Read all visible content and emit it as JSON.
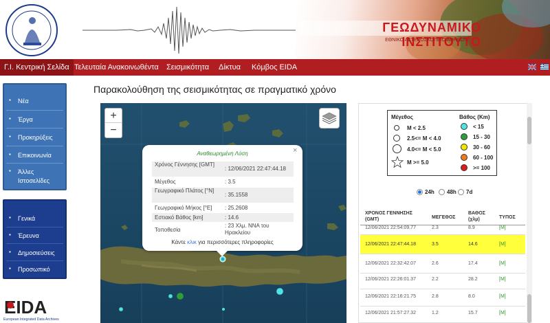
{
  "header": {
    "title": "ΓΕΩΔΥΝΑΜΙΚΟ ΙΝΣΤΙΤΟΥΤΟ",
    "subtitle": "ΕΘΝΙΚΟ ΑΣΤΕΡΟΣΚΟΠΕΙΟ ΑΘΗΝΩΝ"
  },
  "nav": {
    "items": [
      {
        "label": "Γ.Ι. Κεντρική Σελίδα"
      },
      {
        "label": "Τελευταία Ανακοινωθέντα"
      },
      {
        "label": "Σεισμικότητα"
      },
      {
        "label": "Δίκτυα"
      },
      {
        "label": "Κόμβος EIDA"
      }
    ]
  },
  "sidebar": {
    "group1": [
      "Νέα",
      "Έργα",
      "Προκηρύξεις",
      "Επικοινωνία",
      "Άλλες Ιστοσελίδες"
    ],
    "group2": [
      "Γενικά",
      "Έρευνα",
      "Δημοσιεύσεις",
      "Προσωπικό"
    ]
  },
  "eida": {
    "label": "EIDA",
    "caption": "European Integrated Data Archives"
  },
  "page_title": "Παρακολούθηση της σεισμικότητας σε πραγματικό χρόνο",
  "map": {
    "zoom_in": "+",
    "zoom_out": "−",
    "popup": {
      "close": "×",
      "heading": "Αναθεωρημένη Λύση",
      "rows": [
        {
          "key": "Χρόνος Γέννησης [GMT]",
          "value": ": 12/06/2021 22:47:44.18"
        },
        {
          "key": "Μέγεθος",
          "value": ": 3.5"
        },
        {
          "key": "Γεωγραφικό Πλάτος [°N]",
          "value": ": 35.1558"
        },
        {
          "key": "Γεωγραφικό Μήκος [°E]",
          "value": ": 25.2608"
        },
        {
          "key": "Εστιακό Βάθος [km]",
          "value": ": 14.6"
        },
        {
          "key": "Τοποθεσία",
          "value": ": 23 Χλμ. ΝΝΑ του Ηρακλείου"
        }
      ],
      "footer_pre": "Κάντε",
      "footer_link": "κλικ",
      "footer_post": "για περισσότερες πληροφορίες"
    }
  },
  "legend": {
    "magnitude_title": "Μέγεθος",
    "depth_title": "Βάθος (Km)",
    "magnitudes": [
      "M < 2.5",
      "2.5<= M < 4.0",
      "4.0<= M < 5.0",
      "M >= 5.0"
    ],
    "depths": [
      {
        "label": "< 15",
        "color": "#4fe3e3"
      },
      {
        "label": "15 - 30",
        "color": "#2e9e3a"
      },
      {
        "label": "30 - 60",
        "color": "#f2e600"
      },
      {
        "label": "60 - 100",
        "color": "#f07a1a"
      },
      {
        "label": ">= 100",
        "color": "#d81e1e"
      }
    ]
  },
  "period": {
    "options": [
      "24h",
      "48h",
      "7d"
    ],
    "selected": "24h"
  },
  "table": {
    "headers": {
      "time": "ΧΡΟΝΟΣ ΓΕΝΝΗΣΗΣ (GMT)",
      "magnitude": "ΜΕΓΕΘΟΣ",
      "depth": "ΒΑΘΟΣ (χλμ)",
      "type": "ΤΥΠΟΣ"
    },
    "rows": [
      {
        "time": "12/06/2021 22:54:09.77",
        "mag": "2.3",
        "depth": "8.9",
        "type": "[M]"
      },
      {
        "time": "12/06/2021 22:47:44.18",
        "mag": "3.5",
        "depth": "14.6",
        "type": "[M]",
        "highlight": true
      },
      {
        "time": "12/06/2021 22:32:42.07",
        "mag": "2.6",
        "depth": "17.4",
        "type": "[M]"
      },
      {
        "time": "12/06/2021 22:26:01.37",
        "mag": "2.2",
        "depth": "28.2",
        "type": "[M]"
      },
      {
        "time": "12/06/2021 22:16:21.75",
        "mag": "2.8",
        "depth": "8.0",
        "type": "[M]"
      },
      {
        "time": "12/06/2021 21:57:27.32",
        "mag": "1.2",
        "depth": "15.7",
        "type": "[M]"
      }
    ]
  },
  "colors": {
    "nav_bg": "#b01e22",
    "sidebar_light": "#3e73b6",
    "sidebar_dark": "#1d3e8f",
    "highlight_row": "#ffff3c",
    "brand_red": "#c8181d"
  }
}
